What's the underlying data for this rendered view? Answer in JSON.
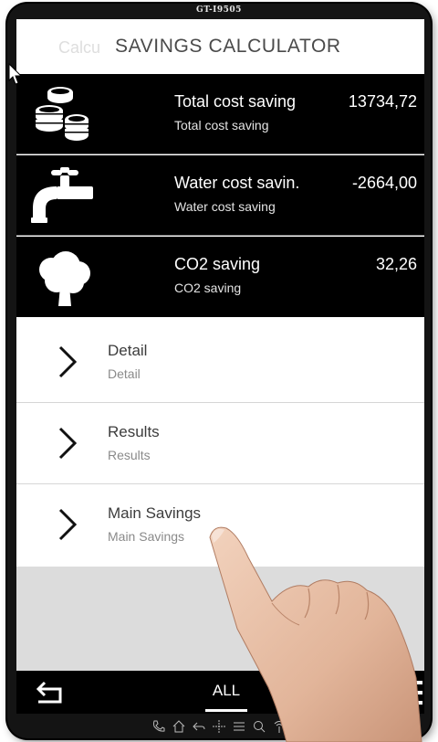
{
  "device": {
    "model": "GT-I9505"
  },
  "header": {
    "title": "SAVINGS CALCULATOR",
    "ghost_text": "Calcu"
  },
  "savings": [
    {
      "icon": "coins-icon",
      "title": "Total cost saving",
      "subtitle": "Total cost saving",
      "value": "13734,72"
    },
    {
      "icon": "water-tap-icon",
      "title": "Water cost savin.",
      "subtitle": "Water cost saving",
      "value": "-2664,00"
    },
    {
      "icon": "tree-icon",
      "title": "CO2 saving",
      "subtitle": "CO2 saving",
      "value": "32,26"
    }
  ],
  "menu": [
    {
      "title": "Detail",
      "subtitle": "Detail"
    },
    {
      "title": "Results",
      "subtitle": "Results"
    },
    {
      "title": "Main Savings",
      "subtitle": "Main Savings"
    }
  ],
  "bottom_bar": {
    "tab_label": "ALL",
    "left_icon": "back-arrow-icon",
    "right_icon": "hamburger-menu-icon"
  },
  "softkeys": [
    "phone-icon",
    "home-icon",
    "back-icon",
    "move-icon",
    "list-icon",
    "search-icon",
    "touch-icon"
  ],
  "colors": {
    "row_background": "#000000",
    "menu_background": "#ffffff",
    "empty_area": "#dcdcdc",
    "header_text": "#4a4a4a"
  }
}
